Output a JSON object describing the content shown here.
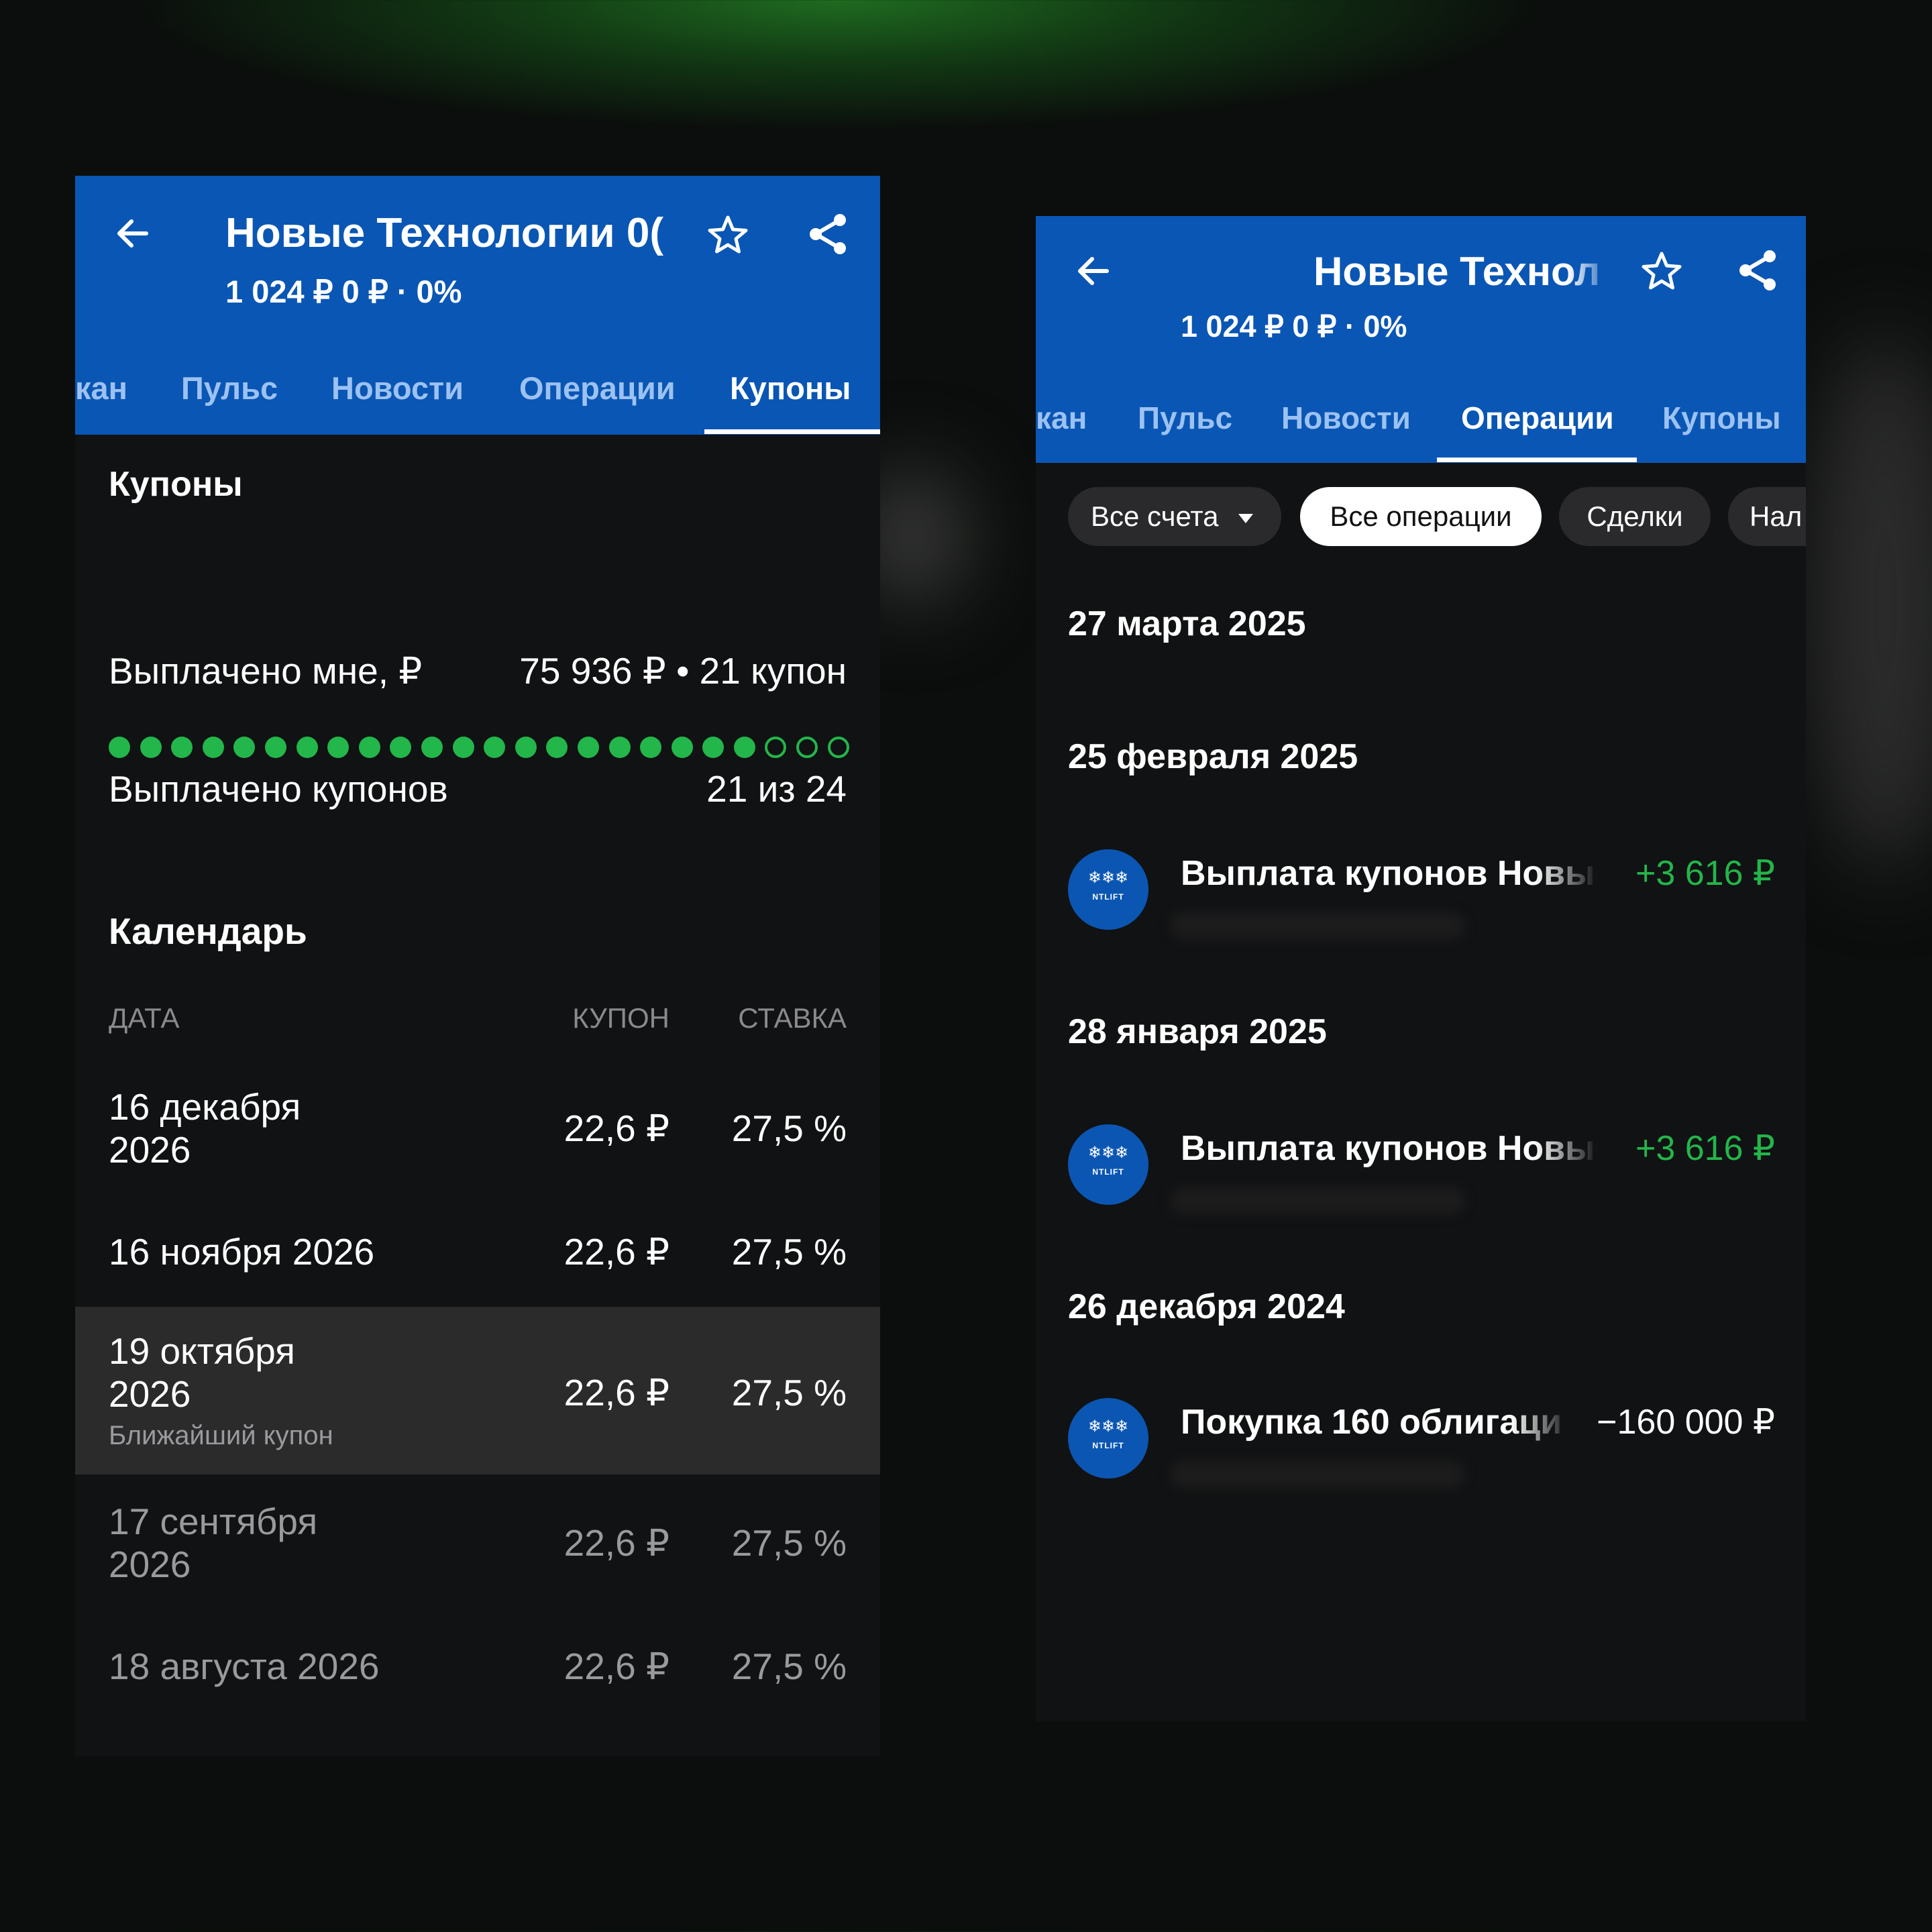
{
  "app": {
    "title": "Новые Технологии 0(",
    "title_short": "Новые Технол",
    "subtitle": "1 024 ₽  0 ₽ · 0%",
    "tabs": [
      "кан",
      "Пульс",
      "Новости",
      "Операции",
      "Купоны"
    ]
  },
  "coupons_screen": {
    "active_tab": "Купоны",
    "section_title": "Купоны",
    "progress": {
      "paid": 21,
      "total": 24
    },
    "paid_label": "Выплачено мне, ₽",
    "paid_value": "75 936 ₽ • 21 купон",
    "count_label": "Выплачено купонов",
    "count_value": "21 из 24",
    "calendar_title": "Календарь",
    "columns": {
      "date": "ДАТА",
      "coupon": "КУПОН",
      "rate": "СТАВКА"
    },
    "rows": [
      {
        "date_line1": "16 декабря",
        "date_line2": "2026",
        "coupon": "22,6 ₽",
        "rate": "27,5 %"
      },
      {
        "date_line1": "16 ноября 2026",
        "coupon": "22,6 ₽",
        "rate": "27,5 %"
      },
      {
        "date_line1": "19 октября",
        "date_line2": "2026",
        "note": "Ближайший купон",
        "coupon": "22,6 ₽",
        "rate": "27,5 %"
      },
      {
        "date_line1": "17 сентября",
        "date_line2": "2026",
        "coupon": "22,6 ₽",
        "rate": "27,5 %"
      },
      {
        "date_line1": "18 августа 2026",
        "coupon": "22,6 ₽",
        "rate": "27,5 %"
      }
    ]
  },
  "operations_screen": {
    "active_tab": "Операции",
    "filters": [
      "Все счета",
      "Все операции",
      "Сделки",
      "Нал"
    ],
    "active_filter": "Все операции",
    "avatar_text": "NTLIFT",
    "groups": [
      {
        "date": "27 марта 2025",
        "items": []
      },
      {
        "date": "25 февраля 2025",
        "items": [
          {
            "title": "Выплата купонов Новые",
            "amount": "+3 616 ₽",
            "type": "income"
          }
        ]
      },
      {
        "date": "28 января 2025",
        "items": [
          {
            "title": "Выплата купонов Новые",
            "amount": "+3 616 ₽",
            "type": "income"
          }
        ]
      },
      {
        "date": "26 декабря 2024",
        "items": [
          {
            "title": "Покупка 160 облигаци",
            "amount": "−160 000 ₽",
            "type": "expense"
          }
        ]
      }
    ]
  },
  "colors": {
    "header_blue": "#0a56b4",
    "green": "#23b64a",
    "panel_bg": "#111213",
    "highlight_row": "#2b2b2c"
  }
}
